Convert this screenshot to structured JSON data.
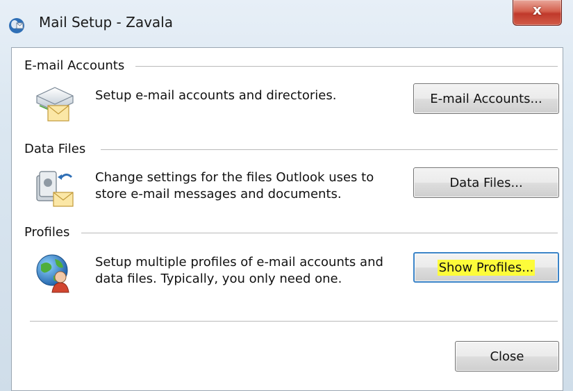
{
  "window": {
    "title": "Mail Setup - Zavala",
    "close_glyph": "x"
  },
  "email_accounts": {
    "section_label": "E-mail Accounts",
    "description": "Setup e-mail accounts and directories.",
    "button_label": "E-mail Accounts...",
    "icon": "mail-server-envelope-icon"
  },
  "data_files": {
    "section_label": "Data Files",
    "description": "Change settings for the files Outlook uses to store e-mail messages and documents.",
    "button_label": "Data Files...",
    "icon": "data-files-icon"
  },
  "profiles": {
    "section_label": "Profiles",
    "description": "Setup multiple profiles of e-mail accounts and data files. Typically, you only need one.",
    "button_label": "Show Profiles...",
    "button_highlight_color": "#fdfc3a",
    "icon": "globe-user-profile-icon"
  },
  "footer": {
    "close_label": "Close"
  }
}
